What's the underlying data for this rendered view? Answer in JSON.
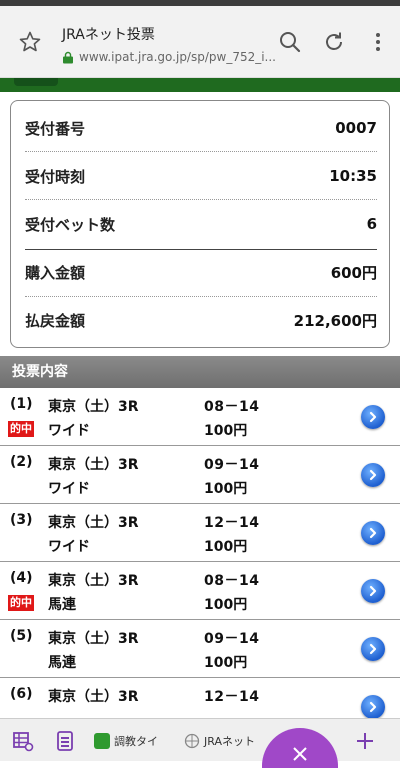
{
  "browser": {
    "tab_title": "JRAネット投票",
    "url": "www.ipat.jra.go.jp/sp/pw_752_i..."
  },
  "summary": {
    "receipt_number": {
      "label": "受付番号",
      "value": "0007"
    },
    "receipt_time": {
      "label": "受付時刻",
      "value": "10:35"
    },
    "bet_count": {
      "label": "受付ベット数",
      "value": "6"
    },
    "purchase_amount": {
      "label": "購入金額",
      "value": "600円"
    },
    "payout_amount": {
      "label": "払戻金額",
      "value": "212,600円"
    }
  },
  "section": {
    "title": "投票内容"
  },
  "hit_label": "的中",
  "bets": [
    {
      "num": "(1)",
      "race": "東京（土）3R",
      "combo": "08－14",
      "type": "ワイド",
      "amount": "100円",
      "hit": true
    },
    {
      "num": "(2)",
      "race": "東京（土）3R",
      "combo": "09－14",
      "type": "ワイド",
      "amount": "100円",
      "hit": false
    },
    {
      "num": "(3)",
      "race": "東京（土）3R",
      "combo": "12－14",
      "type": "ワイド",
      "amount": "100円",
      "hit": false
    },
    {
      "num": "(4)",
      "race": "東京（土）3R",
      "combo": "08－14",
      "type": "馬連",
      "amount": "100円",
      "hit": true
    },
    {
      "num": "(5)",
      "race": "東京（土）3R",
      "combo": "09－14",
      "type": "馬連",
      "amount": "100円",
      "hit": false
    },
    {
      "num": "(6)",
      "race": "東京（土）3R",
      "combo": "12－14",
      "type": "",
      "amount": "",
      "hit": false
    }
  ],
  "bottom_tabs": {
    "tab1": "調教タイ",
    "tab2": "JRAネット"
  },
  "colors": {
    "green_header": "#1f6a1f",
    "hit_red": "#e01818",
    "accent_purple": "#a048c8"
  }
}
